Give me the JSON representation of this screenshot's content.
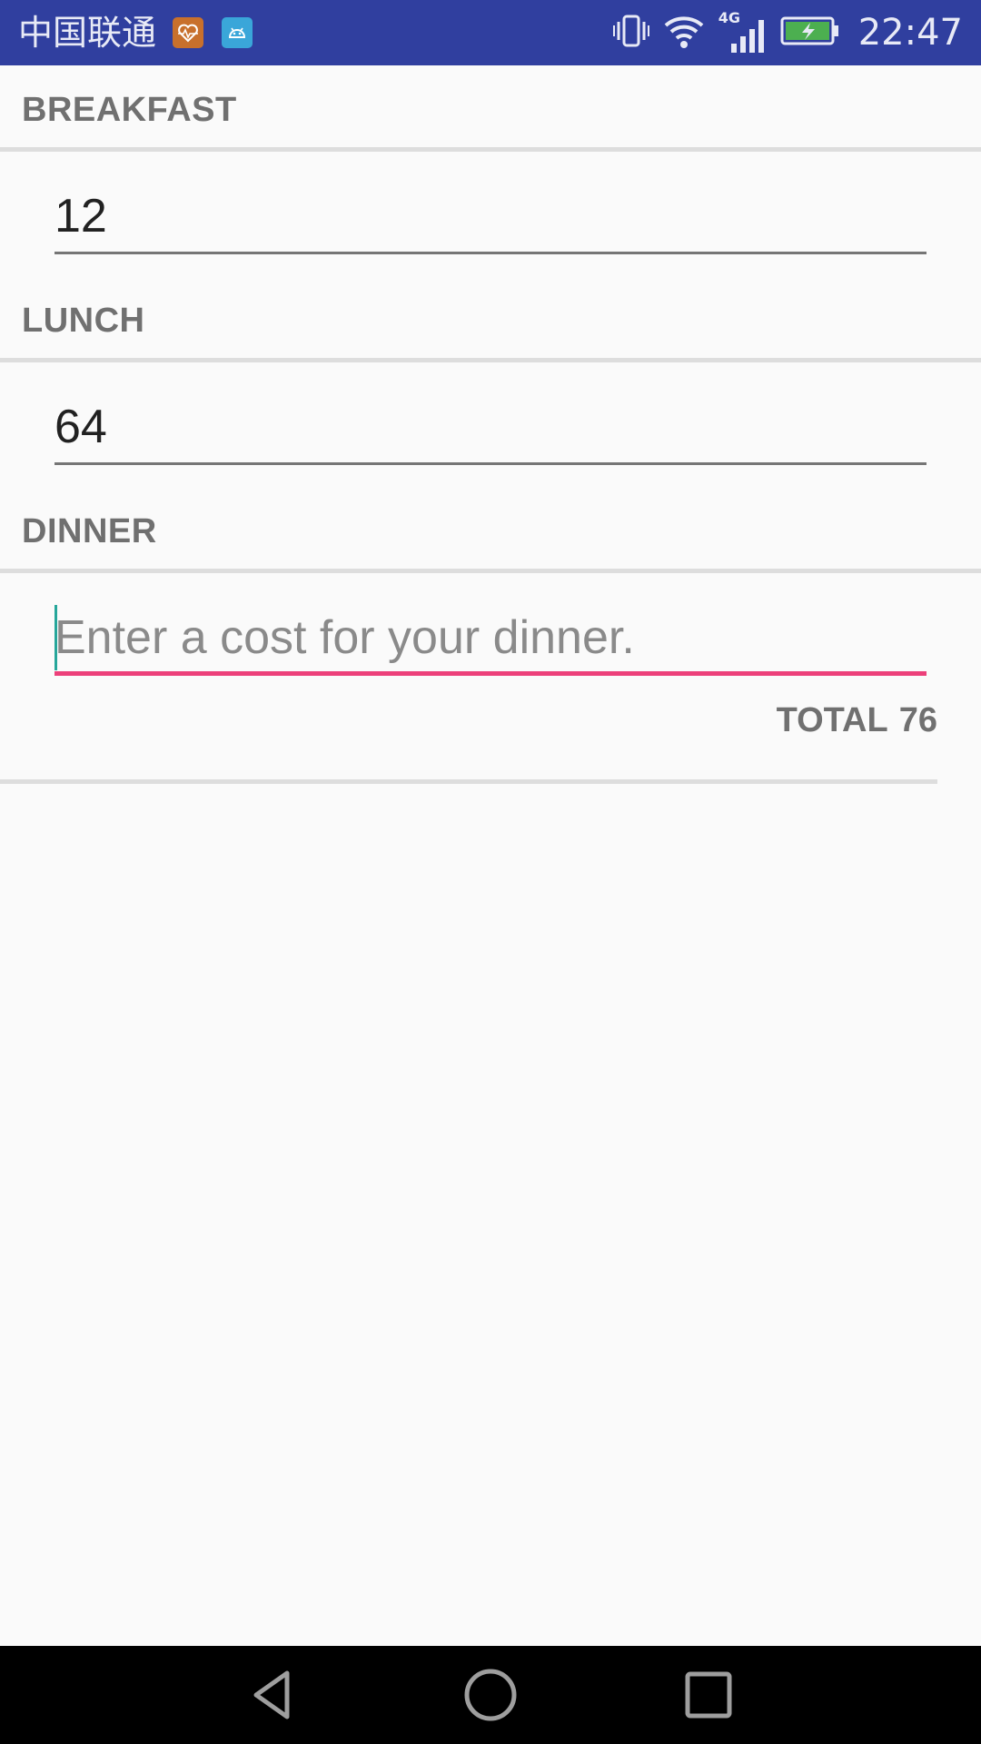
{
  "status_bar": {
    "carrier": "中国联通",
    "time": "22:47",
    "network_type": "4G",
    "background_color": "#303f9f",
    "icons": [
      "health-app-icon",
      "android-icon",
      "vibrate-icon",
      "wifi-icon",
      "signal-icon",
      "battery-charging-icon"
    ]
  },
  "sections": {
    "breakfast": {
      "label": "BREAKFAST",
      "value": "12",
      "placeholder": ""
    },
    "lunch": {
      "label": "LUNCH",
      "value": "64",
      "placeholder": ""
    },
    "dinner": {
      "label": "DINNER",
      "value": "",
      "placeholder": "Enter a cost for your dinner."
    }
  },
  "total": {
    "label": "TOTAL",
    "value": "76"
  },
  "colors": {
    "accent": "#ec407a",
    "cursor": "#26a69a",
    "header_text": "#707070"
  },
  "nav_bar": {
    "icons": [
      "back-icon",
      "home-icon",
      "recent-apps-icon"
    ]
  }
}
